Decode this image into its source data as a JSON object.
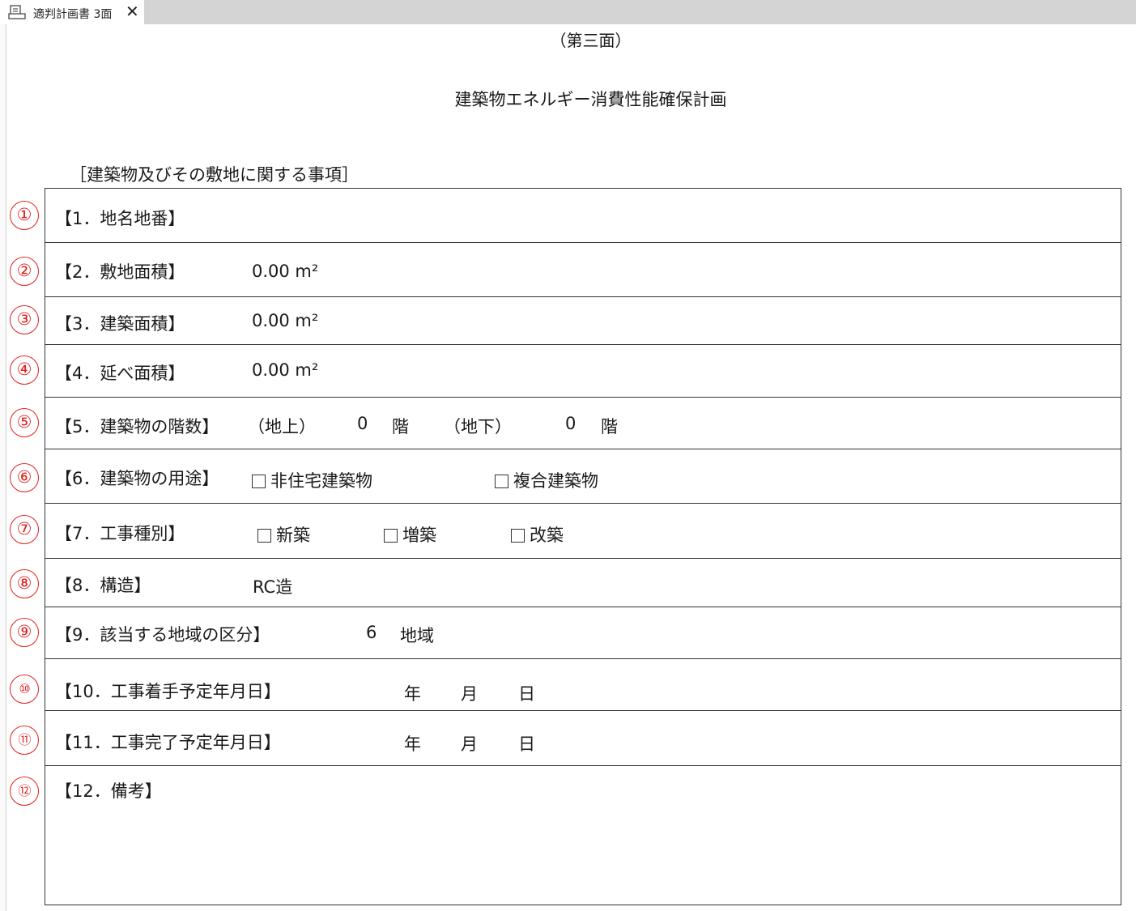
{
  "tab": {
    "title": "適判計画書 3面",
    "close": "✕",
    "icon": "document-print-icon"
  },
  "page_number": "（第三面）",
  "form_title": "建築物エネルギー消費性能確保計画",
  "section_heading": "［建築物及びその敷地に関する事項］",
  "row_markers": [
    "①",
    "②",
    "③",
    "④",
    "⑤",
    "⑥",
    "⑦",
    "⑧",
    "⑨",
    "⑩",
    "⑪",
    "⑫"
  ],
  "items": {
    "location": {
      "label": "【1．地名地番】",
      "value": ""
    },
    "site_area": {
      "label": "【2．敷地面積】",
      "value": "0.00 m²"
    },
    "building_area": {
      "label": "【3．建築面積】",
      "value": "0.00 m²"
    },
    "total_floor_area": {
      "label": "【4．延べ面積】",
      "value": "0.00 m²"
    },
    "floors": {
      "label": "【5．建築物の階数】",
      "above_label": "（地上）",
      "above_value": "0",
      "above_unit": "階",
      "below_label": "（地下）",
      "below_value": "0",
      "below_unit": "階"
    },
    "use": {
      "label": "【6．建築物の用途】",
      "options": [
        "非住宅建築物",
        "複合建築物"
      ]
    },
    "work_type": {
      "label": "【7．工事種別】",
      "options": [
        "新築",
        "増築",
        "改築"
      ]
    },
    "structure": {
      "label": "【8．構造】",
      "value": "RC造"
    },
    "region": {
      "label": "【9．該当する地域の区分】",
      "value": "6",
      "unit": "地域"
    },
    "start_date": {
      "label": "【10．工事着手予定年月日】",
      "year": "年",
      "month": "月",
      "day": "日"
    },
    "end_date": {
      "label": "【11．工事完了予定年月日】",
      "year": "年",
      "month": "月",
      "day": "日"
    },
    "remarks": {
      "label": "【12．備考】",
      "value": ""
    }
  },
  "colors": {
    "marker": "#e02020",
    "border": "#333333",
    "tabbar": "#d4d4d4"
  }
}
